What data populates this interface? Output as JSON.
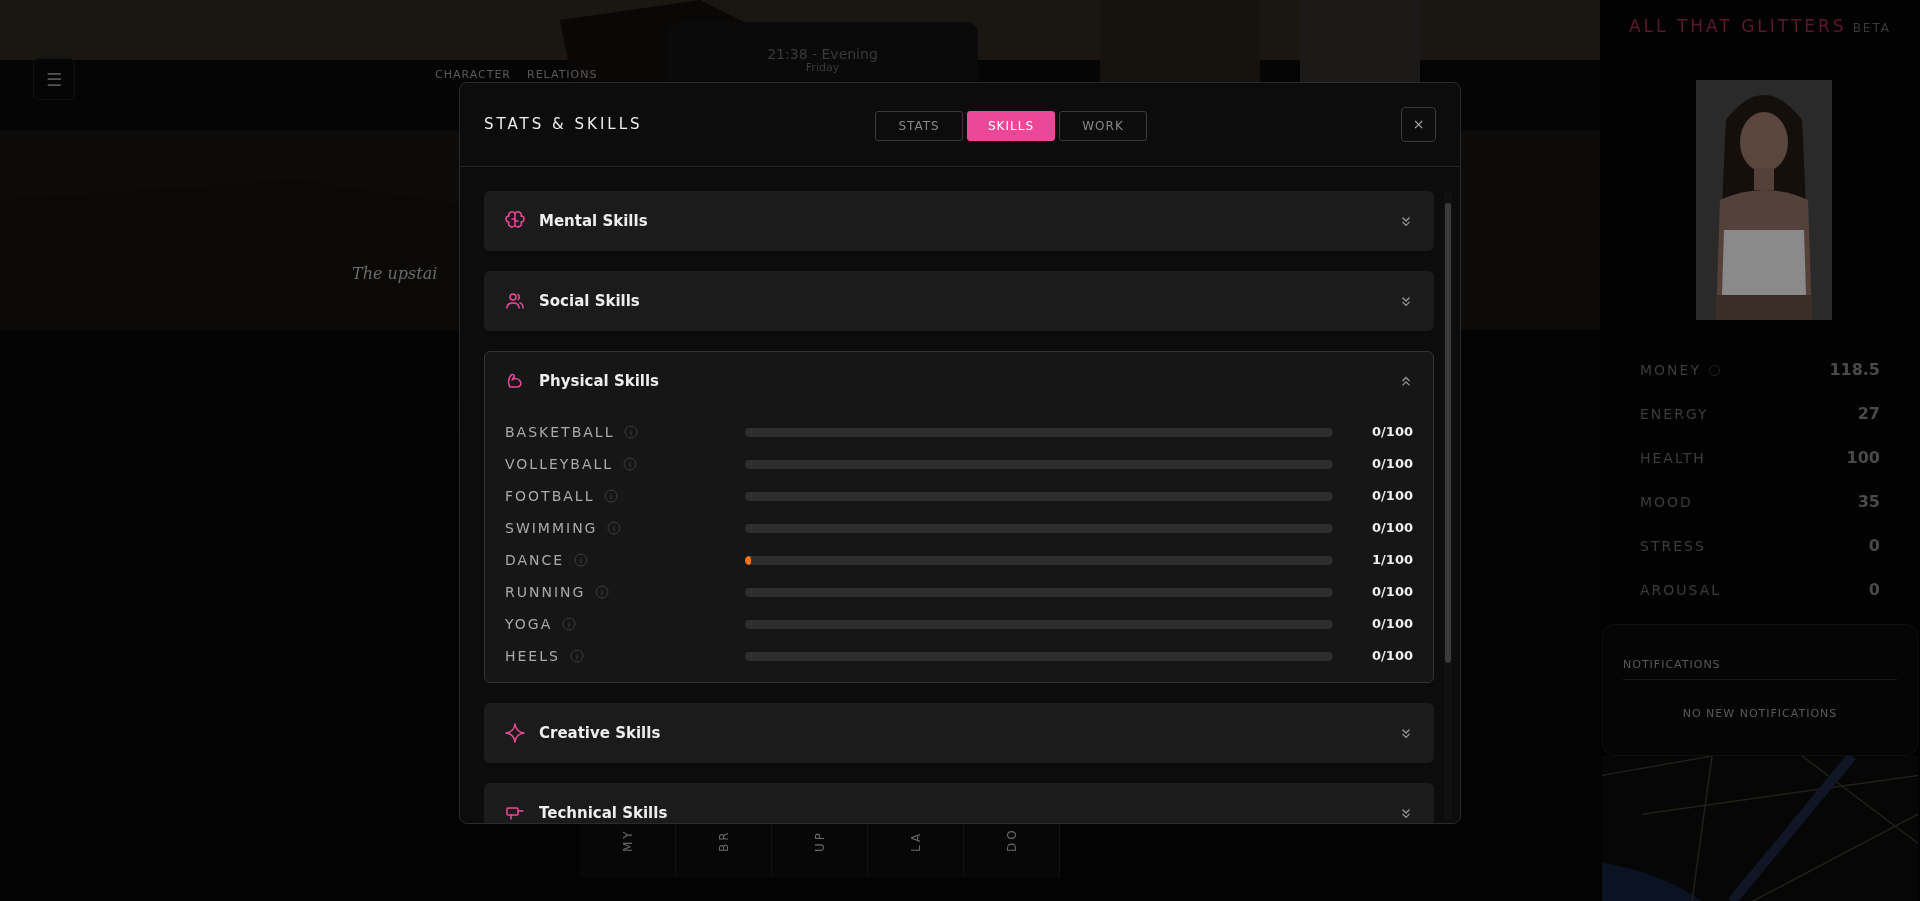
{
  "background": {
    "menu_icon": "☰",
    "nav": [
      "CHARACTER",
      "RELATIONS"
    ],
    "time": "21:38 - Evening",
    "day": "Friday",
    "narration": "The upstai",
    "bottom_tabs": [
      "MY",
      "BR",
      "UP",
      "LA",
      "DO"
    ]
  },
  "sidebar": {
    "title": "ALL THAT GLITTERS",
    "badge": "BETA",
    "stats": [
      {
        "label": "MONEY",
        "value": "118.5",
        "info": true
      },
      {
        "label": "ENERGY",
        "value": "27",
        "info": false
      },
      {
        "label": "HEALTH",
        "value": "100",
        "info": false
      },
      {
        "label": "MOOD",
        "value": "35",
        "info": false
      },
      {
        "label": "STRESS",
        "value": "0",
        "info": false
      },
      {
        "label": "AROUSAL",
        "value": "0",
        "info": false
      }
    ],
    "notifications": {
      "title": "NOTIFICATIONS",
      "empty_text": "NO NEW NOTIFICATIONS"
    }
  },
  "modal": {
    "title": "STATS & SKILLS",
    "close": "×",
    "tabs": [
      {
        "label": "STATS",
        "selected": false
      },
      {
        "label": "SKILLS",
        "selected": true
      },
      {
        "label": "WORK",
        "selected": false
      }
    ],
    "sections": [
      {
        "title": "Mental Skills",
        "expanded": false
      },
      {
        "title": "Social Skills",
        "expanded": false
      },
      {
        "title": "Physical Skills",
        "expanded": true,
        "skills": [
          {
            "name": "BASKETBALL",
            "level": 0,
            "reading": "0/100"
          },
          {
            "name": "VOLLEYBALL",
            "level": 0,
            "reading": "0/100"
          },
          {
            "name": "FOOTBALL",
            "level": 0,
            "reading": "0/100"
          },
          {
            "name": "SWIMMING",
            "level": 0,
            "reading": "0/100"
          },
          {
            "name": "DANCE",
            "level": 0.01,
            "reading": "1/100"
          },
          {
            "name": "RUNNING",
            "level": 0,
            "reading": "0/100"
          },
          {
            "name": "YOGA",
            "level": 0,
            "reading": "0/100"
          },
          {
            "name": "HEELS",
            "level": 0,
            "reading": "0/100"
          }
        ]
      },
      {
        "title": "Creative Skills",
        "expanded": false
      },
      {
        "title": "Technical Skills",
        "expanded": false
      }
    ]
  }
}
